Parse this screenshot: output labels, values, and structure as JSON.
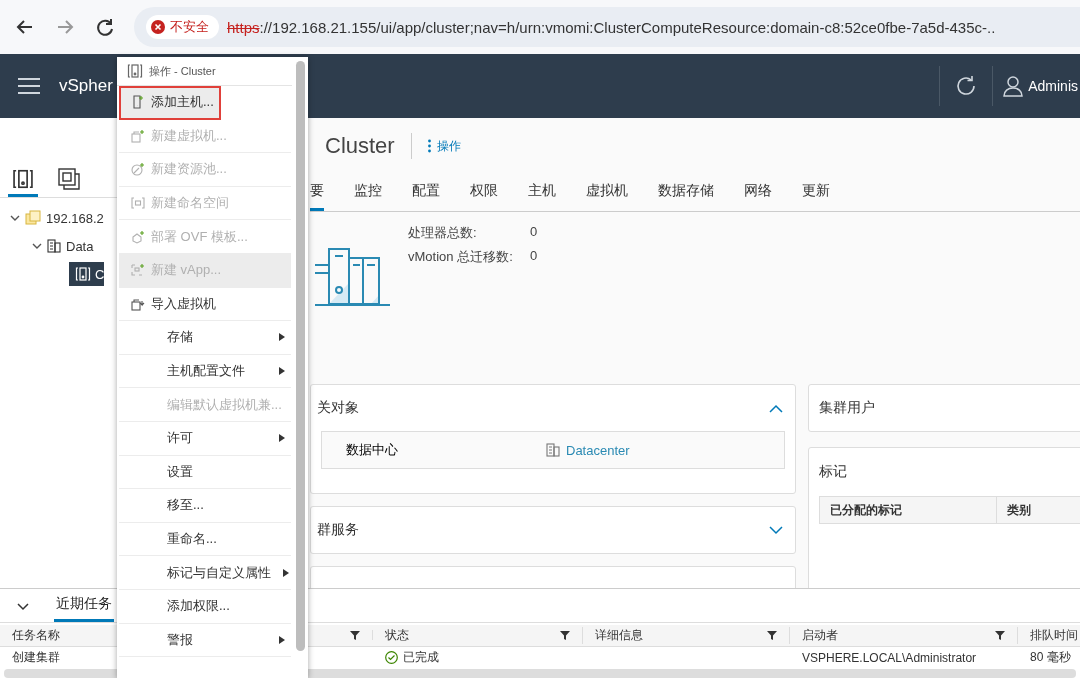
{
  "browser": {
    "security_label": "不安全",
    "url_scheme": "https",
    "url_rest": "://192.168.21.155/ui/app/cluster;nav=h/urn:vmomi:ClusterComputeResource:domain-c8:52ce0fbe-7a5d-435c-.."
  },
  "header": {
    "app_name": "vSpher",
    "user": "Adminis"
  },
  "navigator": {
    "tabs": [
      {
        "selected": true
      },
      {
        "selected": false
      }
    ],
    "tree": [
      {
        "label": "192.168.2",
        "expanded": true,
        "selected": false,
        "children": [
          {
            "label": "Data",
            "expanded": true,
            "selected": false,
            "children": [
              {
                "label": "C",
                "selected": true
              }
            ]
          }
        ]
      }
    ]
  },
  "object": {
    "title": "Cluster",
    "actions_link": "操作"
  },
  "tabs": [
    {
      "label": "要",
      "selected": true
    },
    {
      "label": "监控",
      "selected": false
    },
    {
      "label": "配置",
      "selected": false
    },
    {
      "label": "权限",
      "selected": false
    },
    {
      "label": "主机",
      "selected": false
    },
    {
      "label": "虚拟机",
      "selected": false
    },
    {
      "label": "数据存储",
      "selected": false
    },
    {
      "label": "网络",
      "selected": false
    },
    {
      "label": "更新",
      "selected": false
    }
  ],
  "summary": [
    {
      "label": "处理器总数:",
      "value": "0"
    },
    {
      "label": "vMotion 总迁移数:",
      "value": "0"
    }
  ],
  "left_cards": [
    {
      "title": "关对象",
      "expanded": true,
      "rows": [
        {
          "label": "数据中心",
          "value": "Datacenter"
        }
      ]
    },
    {
      "title": "群服务",
      "expanded": false
    }
  ],
  "right_cards": [
    {
      "title": "集群用户"
    },
    {
      "title": "标记",
      "columns": [
        "已分配的标记",
        "类别"
      ]
    }
  ],
  "tasks": {
    "tab": "近期任务",
    "columns": [
      {
        "label": "任务名称",
        "filter": false
      },
      {
        "filter": true
      },
      {
        "label": "状态",
        "filter": true
      },
      {
        "label": "详细信息",
        "filter": true
      },
      {
        "label": "启动者",
        "filter": true
      },
      {
        "label": "排队时间",
        "filter": false
      }
    ],
    "rows": [
      {
        "task_name": "创建集群",
        "status": "已完成",
        "initiator": "VSPHERE.LOCAL\\Administrator",
        "queued_for": "80 毫秒"
      }
    ]
  },
  "menu": {
    "title": "操作 - Cluster",
    "items": [
      {
        "label": "添加主机...",
        "kind": "icon",
        "disabled": false,
        "highlighted": true,
        "outlined": true
      },
      {
        "label": "新建虚拟机...",
        "kind": "icon",
        "disabled": true,
        "highlighted": false,
        "outlined": false
      },
      {
        "label": "新建资源池...",
        "kind": "icon",
        "disabled": true,
        "highlighted": false,
        "outlined": false
      },
      {
        "label": "新建命名空间",
        "kind": "icon",
        "disabled": true,
        "highlighted": false,
        "outlined": false
      },
      {
        "label": "部署 OVF 模板...",
        "kind": "icon",
        "disabled": true,
        "highlighted": false,
        "outlined": false
      },
      {
        "label": "新建 vApp...",
        "kind": "icon",
        "disabled": true,
        "highlighted": true,
        "outlined": false
      },
      {
        "label": "导入虚拟机",
        "kind": "icon",
        "disabled": false,
        "highlighted": false,
        "outlined": false
      },
      {
        "label": "存储",
        "kind": "submenu",
        "disabled": false,
        "highlighted": false,
        "outlined": false
      },
      {
        "label": "主机配置文件",
        "kind": "submenu",
        "disabled": false,
        "highlighted": false,
        "outlined": false
      },
      {
        "label": "编辑默认虚拟机兼...",
        "kind": "plain",
        "disabled": true,
        "highlighted": false,
        "outlined": false
      },
      {
        "label": "许可",
        "kind": "submenu",
        "disabled": false,
        "highlighted": false,
        "outlined": false
      },
      {
        "label": "设置",
        "kind": "plain",
        "disabled": false,
        "highlighted": false,
        "outlined": false
      },
      {
        "label": "移至...",
        "kind": "plain",
        "disabled": false,
        "highlighted": false,
        "outlined": false
      },
      {
        "label": "重命名...",
        "kind": "plain",
        "disabled": false,
        "highlighted": false,
        "outlined": false
      },
      {
        "label": "标记与自定义属性",
        "kind": "submenu",
        "disabled": false,
        "highlighted": false,
        "outlined": false
      },
      {
        "label": "添加权限...",
        "kind": "plain",
        "disabled": false,
        "highlighted": false,
        "outlined": false
      },
      {
        "label": "警报",
        "kind": "submenu",
        "disabled": false,
        "highlighted": false,
        "outlined": false
      }
    ]
  }
}
